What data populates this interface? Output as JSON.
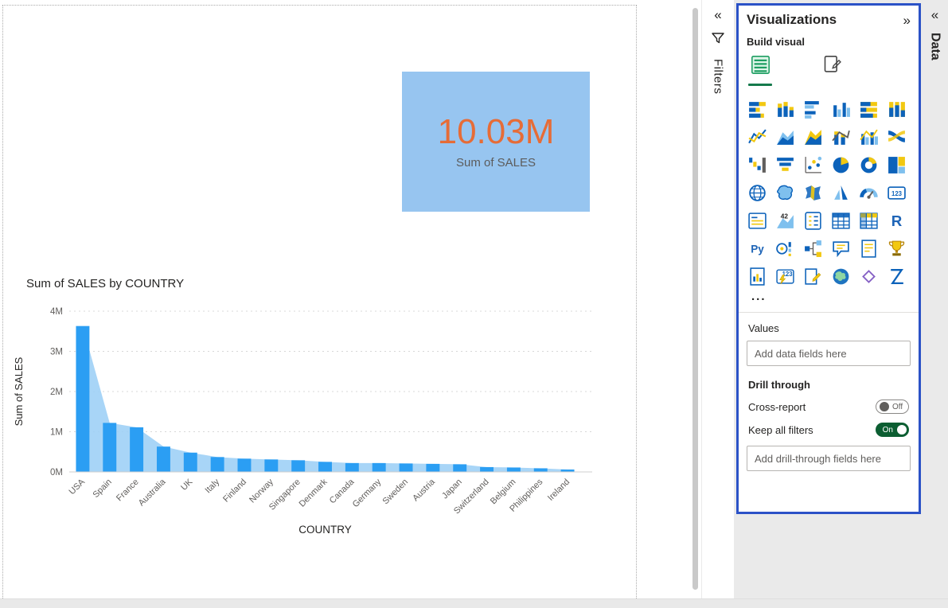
{
  "canvas": {
    "card": {
      "value": "10.03M",
      "label": "Sum of SALES",
      "bg_color": "#97C5F0",
      "value_color": "#E66C37"
    }
  },
  "chart_data": {
    "type": "area",
    "title": "Sum of SALES by COUNTRY",
    "xlabel": "COUNTRY",
    "ylabel": "Sum of SALES",
    "categories": [
      "USA",
      "Spain",
      "France",
      "Australia",
      "UK",
      "Italy",
      "Finland",
      "Norway",
      "Singapore",
      "Denmark",
      "Canada",
      "Germany",
      "Sweden",
      "Austria",
      "Japan",
      "Switzerland",
      "Belgium",
      "Philippines",
      "Ireland"
    ],
    "values_millions": [
      3.63,
      1.22,
      1.11,
      0.63,
      0.48,
      0.37,
      0.33,
      0.31,
      0.29,
      0.25,
      0.22,
      0.22,
      0.21,
      0.2,
      0.19,
      0.12,
      0.11,
      0.09,
      0.06
    ],
    "ylim": [
      0,
      4
    ],
    "yticks": [
      "0M",
      "1M",
      "2M",
      "3M",
      "4M"
    ],
    "grid": "dashed-horizontal",
    "legend": "none",
    "bar_color": "#2B9EF3",
    "area_color": "#9FD0F6"
  },
  "filters_pane": {
    "expand_icon": "«",
    "title": "Filters"
  },
  "visualizations_pane": {
    "title": "Visualizations",
    "collapse_icon": "»",
    "build_section_label": "Build visual",
    "border_color": "#2B52C7",
    "tabs": [
      {
        "name": "build-visual",
        "selected": true
      },
      {
        "name": "format-visual",
        "selected": false
      }
    ],
    "icons": [
      {
        "name": "stacked-bar-chart",
        "glyph": "barsH"
      },
      {
        "name": "stacked-column-chart",
        "glyph": "barsV"
      },
      {
        "name": "clustered-bar-chart",
        "glyph": "barsHc"
      },
      {
        "name": "clustered-column-chart",
        "glyph": "barsVc"
      },
      {
        "name": "100-stacked-bar-chart",
        "glyph": "barsH100"
      },
      {
        "name": "100-stacked-column-chart",
        "glyph": "barsV100"
      },
      {
        "name": "line-chart",
        "glyph": "line"
      },
      {
        "name": "area-chart",
        "glyph": "area"
      },
      {
        "name": "stacked-area-chart",
        "glyph": "sarea"
      },
      {
        "name": "line-and-stacked-column-chart",
        "glyph": "combo"
      },
      {
        "name": "line-and-clustered-column-chart",
        "glyph": "combo2"
      },
      {
        "name": "ribbon-chart",
        "glyph": "ribbon"
      },
      {
        "name": "waterfall-chart",
        "glyph": "waterfall"
      },
      {
        "name": "funnel-chart",
        "glyph": "funnel"
      },
      {
        "name": "scatter-chart",
        "glyph": "scatter"
      },
      {
        "name": "pie-chart",
        "glyph": "pie"
      },
      {
        "name": "donut-chart",
        "glyph": "donut"
      },
      {
        "name": "treemap",
        "glyph": "treemap"
      },
      {
        "name": "map",
        "glyph": "globe"
      },
      {
        "name": "filled-map",
        "glyph": "fmap"
      },
      {
        "name": "shape-map",
        "glyph": "smap"
      },
      {
        "name": "azure-map",
        "glyph": "amap"
      },
      {
        "name": "gauge",
        "glyph": "gauge"
      },
      {
        "name": "card",
        "glyph": "card123"
      },
      {
        "name": "multi-row-card",
        "glyph": "mcard"
      },
      {
        "name": "kpi",
        "glyph": "kpi"
      },
      {
        "name": "slicer",
        "glyph": "slicer"
      },
      {
        "name": "table",
        "glyph": "tableG"
      },
      {
        "name": "matrix",
        "glyph": "matrix"
      },
      {
        "name": "r-script-visual",
        "glyph": "rTxt"
      },
      {
        "name": "python-visual",
        "glyph": "pyTxt"
      },
      {
        "name": "key-influencers",
        "glyph": "keyi"
      },
      {
        "name": "decomposition-tree",
        "glyph": "dtree"
      },
      {
        "name": "q-and-a",
        "glyph": "qa"
      },
      {
        "name": "smart-narrative",
        "glyph": "narr"
      },
      {
        "name": "metrics-trophy",
        "glyph": "trophy"
      },
      {
        "name": "paginated-report",
        "glyph": "pgchart"
      },
      {
        "name": "power-automate",
        "glyph": "bolt123"
      },
      {
        "name": "scorecard",
        "glyph": "pgpen"
      },
      {
        "name": "arcgis-map",
        "glyph": "globef"
      },
      {
        "name": "power-apps",
        "glyph": "diamond"
      },
      {
        "name": "custom-visual",
        "glyph": "zed"
      }
    ],
    "more_label": "...",
    "values_section_label": "Values",
    "values_placeholder": "Add data fields here",
    "drill_through_label": "Drill through",
    "cross_report_label": "Cross-report",
    "cross_report_state": "Off",
    "keep_all_filters_label": "Keep all filters",
    "keep_all_filters_state": "On",
    "toggle_on_color": "#0C5E32"
  },
  "data_pane": {
    "expand_icon": "«",
    "drill_placeholder": "Add drill-through fields here",
    "title": "Data"
  }
}
